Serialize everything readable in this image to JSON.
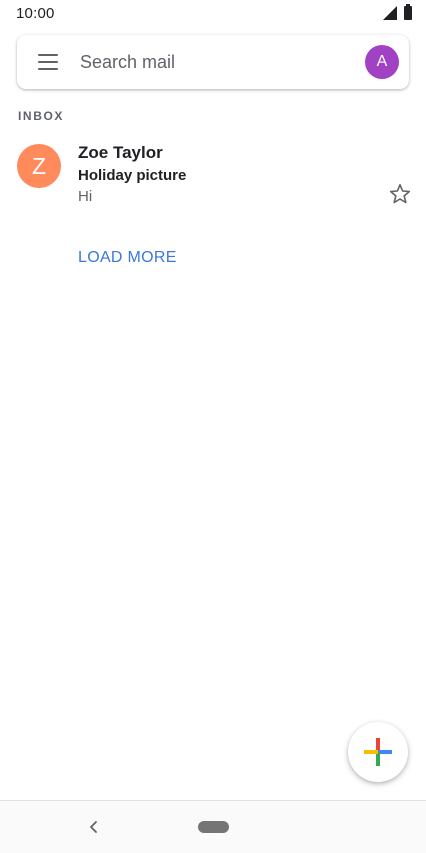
{
  "status_bar": {
    "time": "10:00",
    "signal_icon": "signal-icon",
    "battery_icon": "battery-icon"
  },
  "search": {
    "menu_icon": "menu-icon",
    "placeholder": "Search mail",
    "value": "",
    "account_initial": "A",
    "account_color": "#a142c4"
  },
  "inbox": {
    "label": "INBOX",
    "emails": [
      {
        "avatar_initial": "Z",
        "avatar_color": "#ff8a5c",
        "sender": "Zoe Taylor",
        "subject": "Holiday picture",
        "snippet": "Hi",
        "starred": false
      }
    ],
    "load_more_label": "LOAD MORE"
  },
  "compose": {
    "icon": "plus-icon",
    "colors": [
      "#ea4335",
      "#fbbc04",
      "#34a853",
      "#4285f4"
    ]
  },
  "nav_bar": {
    "back_icon": "back-icon",
    "home_icon": "home-pill-icon"
  },
  "colors": {
    "link": "#3b78d8",
    "text_primary": "#202124",
    "text_secondary": "#5f6368"
  }
}
